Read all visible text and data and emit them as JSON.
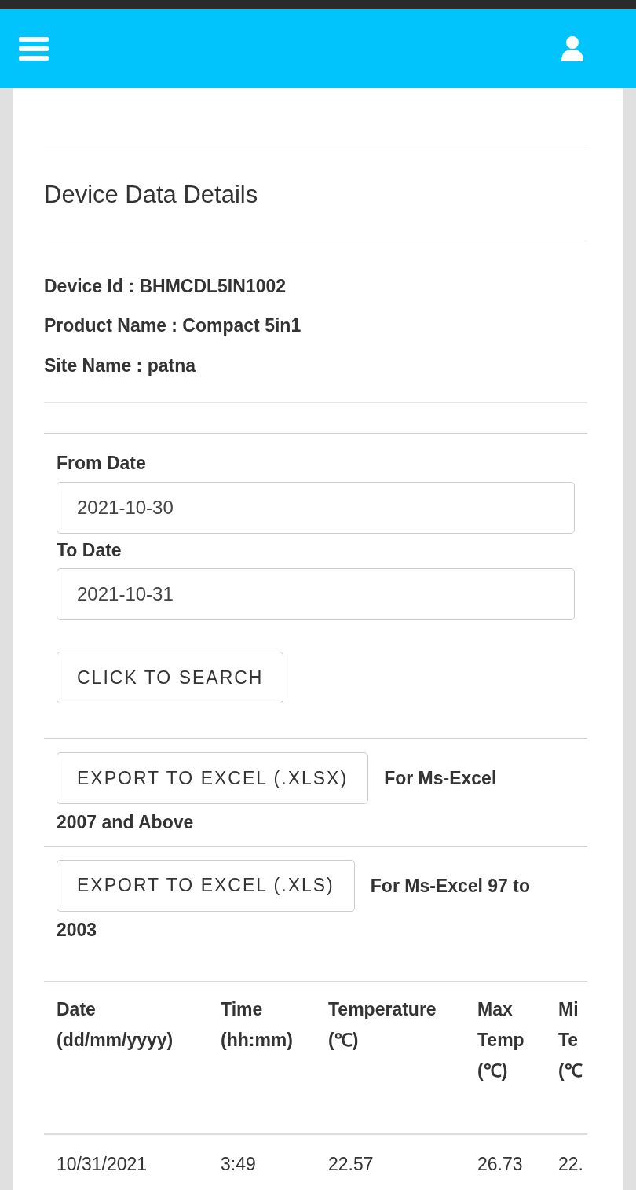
{
  "title": "Device Data Details",
  "details": [
    "Device Id : BHMCDL5IN1002",
    "Product Name : Compact 5in1",
    "Site Name : patna"
  ],
  "from_date": {
    "label": "From Date",
    "value": "2021-10-30"
  },
  "to_date": {
    "label": "To Date",
    "value": "2021-10-31"
  },
  "search_button": "CLICK TO SEARCH",
  "exports": [
    {
      "button": "EXPORT TO EXCEL (.XLSX)",
      "note": [
        "For Ms-Excel",
        "2007 and Above"
      ]
    },
    {
      "button": "EXPORT TO EXCEL (.XLS)",
      "note": [
        "For Ms-Excel 97 to",
        "2003"
      ]
    }
  ],
  "table": {
    "columns": [
      "Date (dd/mm/yyyy)",
      "Time (hh:mm)",
      "Temperature (℃)",
      "Max Temp (℃)",
      "Mi Te (℃"
    ],
    "rows": [
      [
        "10/31/2021",
        "3:49",
        "22.57",
        "26.73",
        "22."
      ]
    ]
  }
}
